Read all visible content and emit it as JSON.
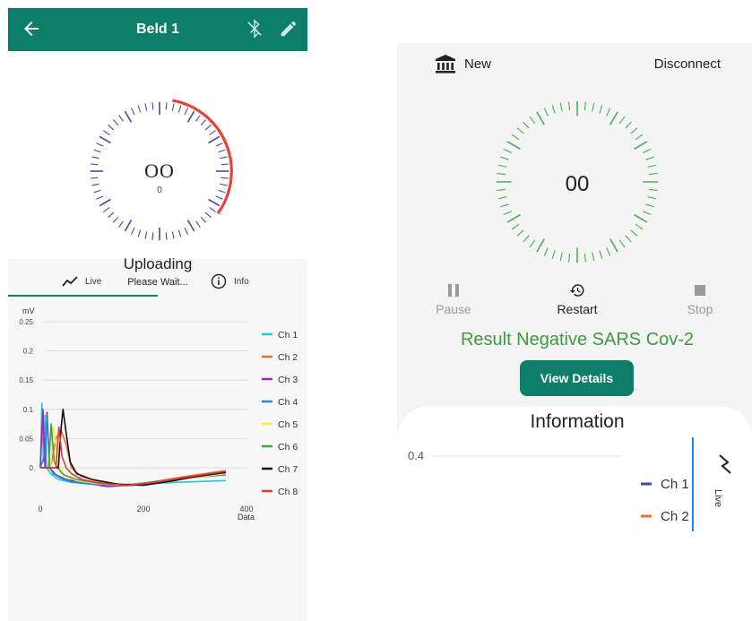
{
  "left_screen": {
    "title": "Beld 1",
    "icons": {
      "back": "arrow-left-icon",
      "bluetooth": "bluetooth-disabled-icon",
      "edit": "pencil-icon"
    },
    "dial": {
      "value": "OO",
      "sub_value": "0"
    },
    "status": "Uploading",
    "status_sub": "Please Wait...",
    "tabs": [
      {
        "label": "Live",
        "icon": "trend-line-icon",
        "active": true
      },
      {
        "label": "Info",
        "icon": "info-circle-icon",
        "active": false
      }
    ],
    "colors": {
      "accent": "#0d7e6a",
      "dial_ticks": "#4a4a9a",
      "dial_arc": "#e0453a"
    }
  },
  "right_screen": {
    "new_label": "New",
    "disconnect_label": "Disconnect",
    "dial": {
      "value": "00"
    },
    "controls": [
      {
        "label": "Pause",
        "icon": "pause-icon",
        "enabled": false
      },
      {
        "label": "Restart",
        "icon": "restart-history-icon",
        "enabled": true
      },
      {
        "label": "Stop",
        "icon": "stop-icon",
        "enabled": false
      }
    ],
    "result": "Result Negative SARS Cov-2",
    "view_details_label": "View Details",
    "information_title": "Information",
    "live_label": "Live",
    "colors": {
      "accent": "#0d7e6a",
      "dial_ticks": "#4caf50",
      "result": "#3f9a3f"
    }
  },
  "chart_data": [
    {
      "type": "line",
      "ylabel": "mV",
      "xlabel": "Data",
      "ylim": [
        -0.03,
        0.25
      ],
      "xlim": [
        0,
        400
      ],
      "yticks": [
        "0.25",
        "0.2",
        "0.15",
        "0.1",
        "0.05",
        "0"
      ],
      "ytick_values": [
        0.25,
        0.2,
        0.15,
        0.1,
        0.05,
        0
      ],
      "xticks": [
        "0",
        "200",
        "400"
      ],
      "xtick_values": [
        0,
        200,
        400
      ],
      "grid": true,
      "legend_position": "right",
      "series": [
        {
          "name": "Ch 1",
          "color": "#26c6da",
          "x": [
            0,
            3,
            6,
            9,
            12,
            20,
            35,
            60,
            100,
            150,
            200,
            260,
            360
          ],
          "y": [
            0,
            0.11,
            0.01,
            0.09,
            0.0,
            -0.01,
            -0.02,
            -0.025,
            -0.028,
            -0.03,
            -0.028,
            -0.025,
            -0.022
          ]
        },
        {
          "name": "Ch 2",
          "color": "#ef6c35",
          "x": [
            0,
            10,
            20,
            30,
            40,
            50,
            60,
            80,
            120,
            170,
            220,
            280,
            360
          ],
          "y": [
            0,
            0,
            0,
            0.05,
            0.065,
            0.04,
            0.0,
            -0.015,
            -0.025,
            -0.03,
            -0.024,
            -0.015,
            -0.005
          ]
        },
        {
          "name": "Ch 3",
          "color": "#9c27b0",
          "x": [
            0,
            5,
            9,
            13,
            18,
            30,
            50,
            80,
            130,
            180,
            240,
            300,
            360
          ],
          "y": [
            0,
            0.1,
            0.0,
            0.095,
            0.0,
            -0.012,
            -0.02,
            -0.025,
            -0.032,
            -0.03,
            -0.024,
            -0.016,
            -0.008
          ]
        },
        {
          "name": "Ch 4",
          "color": "#1e88e5",
          "x": [
            0,
            8,
            13,
            18,
            25,
            40,
            60,
            100,
            150,
            200,
            260,
            360
          ],
          "y": [
            0,
            0.02,
            0.085,
            0.0,
            -0.01,
            -0.018,
            -0.024,
            -0.028,
            -0.03,
            -0.026,
            -0.02,
            -0.012
          ]
        },
        {
          "name": "Ch 5",
          "color": "#ffeb3b",
          "x": [
            0,
            20,
            25,
            30,
            36,
            50,
            70,
            110,
            160,
            220,
            290,
            360
          ],
          "y": [
            0,
            0,
            0.07,
            0.04,
            0.0,
            -0.015,
            -0.022,
            -0.027,
            -0.03,
            -0.025,
            -0.018,
            -0.01
          ]
        },
        {
          "name": "Ch 6",
          "color": "#43a047",
          "x": [
            0,
            16,
            21,
            27,
            33,
            45,
            70,
            110,
            170,
            230,
            300,
            360
          ],
          "y": [
            0,
            0,
            0.075,
            0.01,
            0.0,
            -0.012,
            -0.02,
            -0.026,
            -0.03,
            -0.024,
            -0.016,
            -0.008
          ]
        },
        {
          "name": "Ch 7",
          "color": "#111111",
          "x": [
            0,
            35,
            40,
            44,
            50,
            58,
            70,
            100,
            150,
            200,
            260,
            300,
            360
          ],
          "y": [
            0,
            0,
            0.065,
            0.1,
            0.06,
            0.01,
            -0.01,
            -0.02,
            -0.028,
            -0.03,
            -0.022,
            -0.015,
            -0.008
          ]
        },
        {
          "name": "Ch 8",
          "color": "#e53935",
          "x": [
            0,
            30,
            36,
            42,
            50,
            60,
            80,
            120,
            170,
            230,
            290,
            360
          ],
          "y": [
            0,
            0,
            0.07,
            0.02,
            0.0,
            -0.01,
            -0.02,
            -0.027,
            -0.03,
            -0.024,
            -0.015,
            -0.006
          ]
        }
      ]
    },
    {
      "type": "line",
      "yticks": [
        "0.4"
      ],
      "ytick_values": [
        0.4
      ],
      "grid": true,
      "legend_position": "right",
      "series": [
        {
          "name": "Ch 1",
          "color": "#3949ab"
        },
        {
          "name": "Ch 2",
          "color": "#ef6c35"
        }
      ]
    }
  ]
}
